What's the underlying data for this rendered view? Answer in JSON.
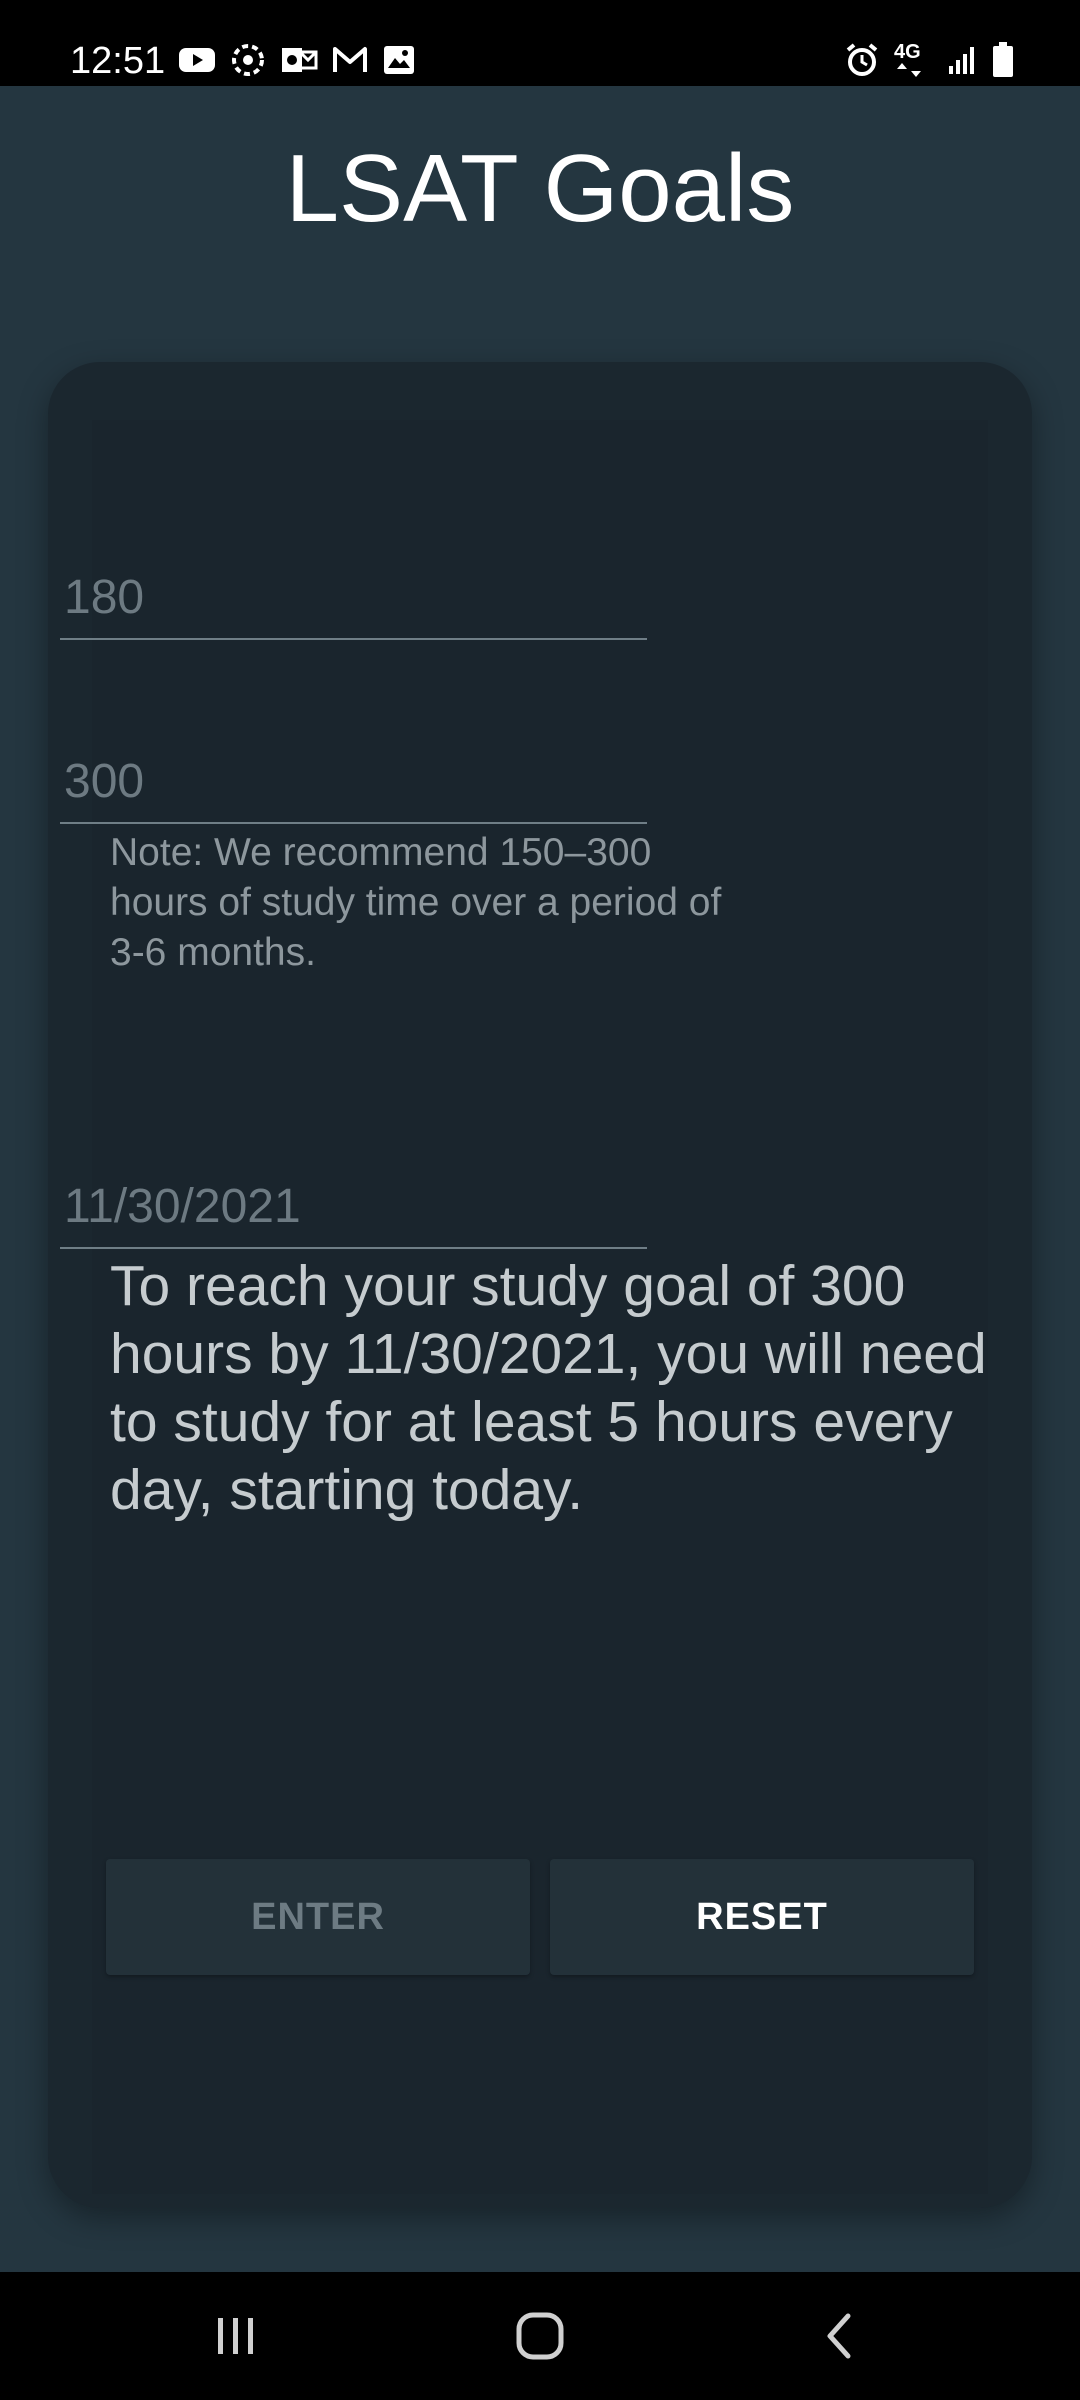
{
  "status_bar": {
    "time": "12:51",
    "left_icons": [
      "youtube-icon",
      "sync-icon",
      "outlook-icon",
      "gmail-icon",
      "gallery-icon"
    ],
    "right_icons": [
      "alarm-icon",
      "4g-lte-icon",
      "signal-icon",
      "battery-icon"
    ],
    "network_label": "4G"
  },
  "app": {
    "title": "LSAT Goals",
    "background_color": "#243640",
    "card_color": "#1b272f"
  },
  "form": {
    "score_field": {
      "value": "",
      "placeholder": "180"
    },
    "hours_field": {
      "value": "",
      "placeholder": "300"
    },
    "note": "Note: We recommend 150–300 hours of study time over a period of 3-6 months.",
    "date_field": {
      "value": "",
      "placeholder": "11/30/2021"
    },
    "result_text": "To reach your study goal of 300 hours by 11/30/2021, you will need to study for at least 5 hours every day, starting today.",
    "enter_label": "ENTER",
    "reset_label": "RESET"
  },
  "nav_bar": {
    "buttons": [
      "recent-apps-icon",
      "home-icon",
      "back-icon"
    ]
  }
}
